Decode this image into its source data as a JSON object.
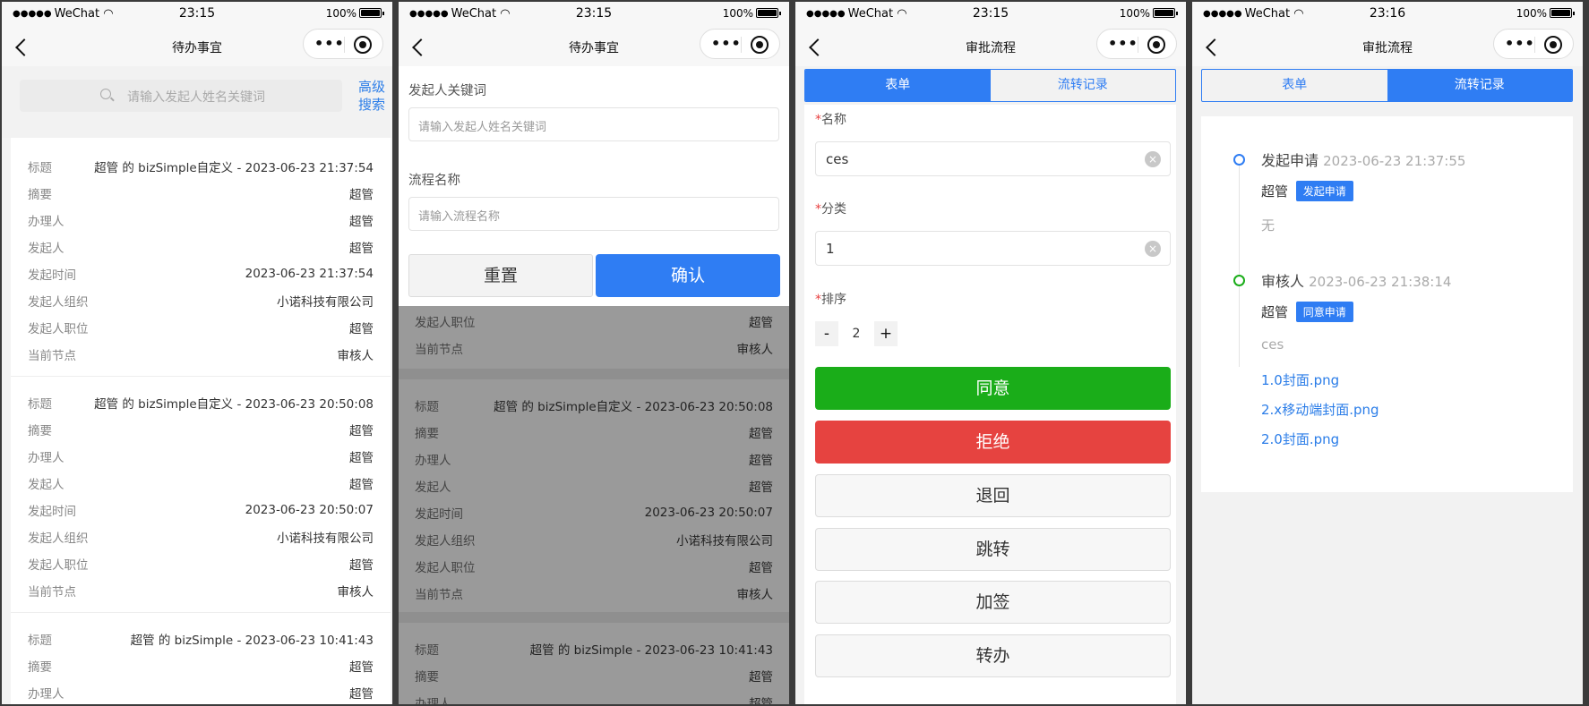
{
  "status": {
    "carrier": "WeChat",
    "battery": "100%"
  },
  "screens": {
    "s1": {
      "time": "23:15",
      "title": "待办事宜"
    },
    "s2": {
      "time": "23:15",
      "title": "待办事宜"
    },
    "s3": {
      "time": "23:15",
      "title": "审批流程"
    },
    "s4": {
      "time": "23:16",
      "title": "审批流程"
    }
  },
  "search": {
    "placeholder": "请输入发起人姓名关键词",
    "advanced": "高级搜索"
  },
  "fields": {
    "title": "标题",
    "summary": "摘要",
    "handler": "办理人",
    "initiator": "发起人",
    "start_time": "发起时间",
    "org": "发起人组织",
    "position": "发起人职位",
    "node": "当前节点"
  },
  "tasks": [
    {
      "title": "超管 的 bizSimple自定义 - 2023-06-23 21:37:54",
      "summary": "超管",
      "handler": "超管",
      "initiator": "超管",
      "start_time": "2023-06-23 21:37:54",
      "org": "小诺科技有限公司",
      "position": "超管",
      "node": "审核人"
    },
    {
      "title": "超管 的 bizSimple自定义 - 2023-06-23 20:50:08",
      "summary": "超管",
      "handler": "超管",
      "initiator": "超管",
      "start_time": "2023-06-23 20:50:07",
      "org": "小诺科技有限公司",
      "position": "超管",
      "node": "审核人"
    },
    {
      "title": "超管 的 bizSimple - 2023-06-23 10:41:43",
      "summary": "超管",
      "handler": "超管"
    }
  ],
  "filter": {
    "keyword_label": "发起人关键词",
    "keyword_placeholder": "请输入发起人姓名关键词",
    "flow_label": "流程名称",
    "flow_placeholder": "请输入流程名称",
    "reset": "重置",
    "confirm": "确认"
  },
  "tabs": {
    "form": "表单",
    "record": "流转记录"
  },
  "form": {
    "name_label": "名称",
    "name_value": "ces",
    "category_label": "分类",
    "category_value": "1",
    "sort_label": "排序",
    "sort_value": "2",
    "minus": "-",
    "plus": "+",
    "clear": "×",
    "required": "*"
  },
  "actions": {
    "agree": "同意",
    "reject": "拒绝",
    "return": "退回",
    "jump": "跳转",
    "add_sign": "加签",
    "transfer": "转办"
  },
  "record": {
    "items": [
      {
        "node": "发起申请",
        "time": "2023-06-23 21:37:55",
        "user": "超管",
        "tag": "发起申请",
        "comment": "无"
      },
      {
        "node": "审核人",
        "time": "2023-06-23 21:38:14",
        "user": "超管",
        "tag": "同意申请",
        "comment": "ces"
      }
    ],
    "files": [
      "1.0封面.png",
      "2.x移动端封面.png",
      "2.0封面.png"
    ]
  },
  "colors": {
    "primary": "#2f7df3",
    "agree": "#1aad19",
    "reject": "#e64340"
  }
}
